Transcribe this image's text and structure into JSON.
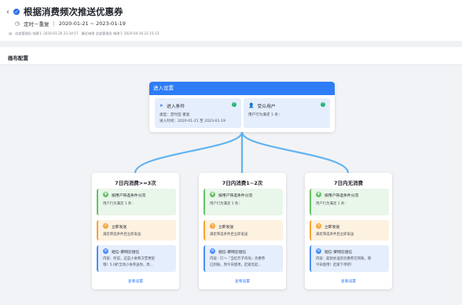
{
  "header": {
    "back_glyph": "‹",
    "title": "根据消费频次推送优惠券",
    "schedule_type": "定时－重复",
    "date_range": "2020-01-21 ~ 2023-01-19",
    "meta_icon": "▤",
    "creator": "总部管理员 创建于 2020-01-20 22:34:57",
    "modifier": "最近修改 总部管理员 修改于 2020-04-16 21:15:13"
  },
  "section": {
    "title": "画布配置"
  },
  "entry": {
    "title": "进入设置",
    "condition": {
      "title": "进入条件",
      "line1": "类型：定时型-重复",
      "line2": "进入时间：2020-01-21 至 2023-01-19"
    },
    "audience": {
      "title": "受众用户",
      "line1": "用户行为满足 1 条："
    }
  },
  "branches": [
    {
      "title": "7日内消费>=3次",
      "filter_label": "按用户筛选条件分流",
      "filter_text": "用户行为满足 1 条：",
      "send_label": "立即发送",
      "send_text": "满足筛选条件后立即发送",
      "sms_label": "短信-萝网云短信",
      "sms_line1": "内容：听说，这些小食和汉堡更配",
      "sms_line2": "哦！5.0折全场小食券送你，周…",
      "view": "查看设置"
    },
    {
      "title": "7日内消费1~2次",
      "filter_label": "按用户筛选条件分流",
      "filter_text": "用户行为满足 1 条：",
      "send_label": "立即发送",
      "send_text": "满足筛选条件后立即发送",
      "sms_label": "短信-萝网云短信",
      "sms_line1": "内容：叮～『当红炸子鸡块』优惠券",
      "sms_line2": "已到账，周今日使用，赶紧吃起…",
      "view": "查看设置"
    },
    {
      "title": "7日内无消费",
      "filter_label": "按用户筛选条件分流",
      "filter_text": "用户行为满足 1 条：",
      "send_label": "立即发送",
      "send_text": "满足筛选条件后立即发送",
      "sms_label": "短信-萝网云短信",
      "sms_line1": "内容：超组亦送您优惠券已到账，限",
      "sms_line2": "今日使用！赶紧下单吧！",
      "view": "查看设置"
    }
  ],
  "colors": {
    "accent": "#2e7cf6",
    "connector": "#5fb3f0",
    "success": "#22b573"
  }
}
